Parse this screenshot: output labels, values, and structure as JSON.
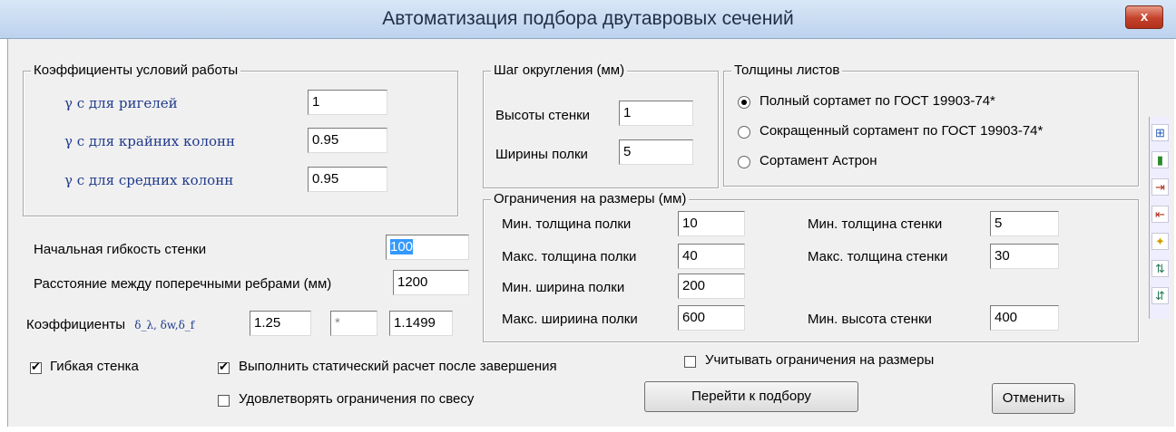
{
  "window": {
    "title": "Автоматизация подбора двутавровых сечений",
    "close_label": "x"
  },
  "work_coeffs": {
    "legend": "Коэффициенты условий работы",
    "rows": [
      {
        "label": "γ с  для ригелей",
        "value": "1"
      },
      {
        "label": "γ с  для крайних колонн",
        "value": "0.95"
      },
      {
        "label": "γ с  для средних колонн",
        "value": "0.95"
      }
    ]
  },
  "rounding": {
    "legend": "Шаг округления (мм)",
    "wall_label": "Высоты стенки",
    "wall_value": "1",
    "flange_label": "Ширины полки",
    "flange_value": "5"
  },
  "thickness": {
    "legend": "Толщины листов",
    "options": [
      {
        "label": "Полный сортамет по ГОСТ 19903-74*",
        "selected": true
      },
      {
        "label": "Сокращенный сортамент по ГОСТ 19903-74*",
        "selected": false
      },
      {
        "label": "Сортамент Астрон",
        "selected": false
      }
    ]
  },
  "limits": {
    "legend": "Ограничения на размеры (мм)",
    "left": [
      {
        "label": "Мин. толщина полки",
        "value": "10"
      },
      {
        "label": "Макс. толщина полки",
        "value": "40"
      },
      {
        "label": "Мин. ширина полки",
        "value": "200"
      },
      {
        "label": "Макс. шириина полки",
        "value": "600"
      }
    ],
    "right": [
      {
        "label": "Мин. толщина стенки",
        "value": "5"
      },
      {
        "label": "Макс. толщина стенки",
        "value": "30"
      },
      {
        "label": "Мин. высота стенки",
        "value": "400"
      }
    ]
  },
  "params": {
    "flex_label": "Начальная гибкость стенки",
    "flex_value": "100",
    "rib_label": "Расстояние между поперечными ребрами (мм)",
    "rib_value": "1200",
    "coef_label": "Коэффициенты",
    "coef_symbols": "δ_λ, δw,δ_f",
    "coef_values": [
      "1.25",
      "*",
      "1.1499"
    ]
  },
  "checks": {
    "flexible_wall": {
      "label": "Гибкая стенка",
      "checked": true
    },
    "static_calc": {
      "label": "Выполнить статический расчет после завершения",
      "checked": true
    },
    "weight_limit": {
      "label": "Удовлетворять ограничения по свесу",
      "checked": false
    },
    "size_limits": {
      "label": "Учитывать ограничения на размеры",
      "checked": false
    }
  },
  "buttons": {
    "go": "Перейти к подбору",
    "cancel": "Отменить"
  },
  "toolbar_icons": [
    "grid-icon",
    "bar-chart-icon",
    "arrow-right-icon",
    "arrow-left-icon",
    "star-icon",
    "import-icon",
    "export-icon"
  ]
}
